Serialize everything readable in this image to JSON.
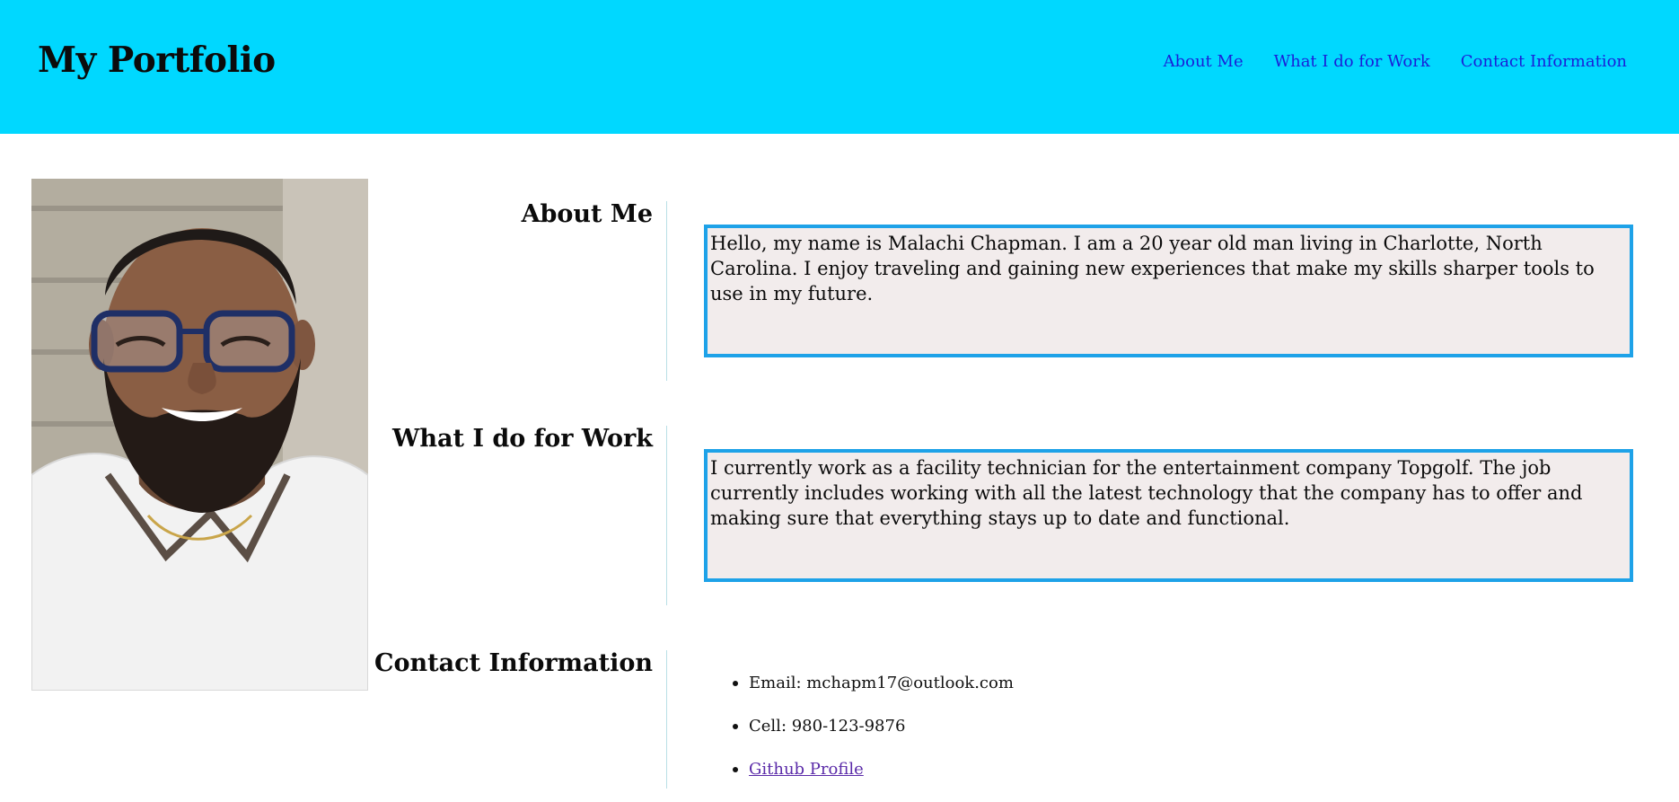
{
  "header": {
    "title": "My Portfolio",
    "nav": [
      "About Me",
      "What I do for Work",
      "Contact Information"
    ]
  },
  "sections": {
    "about": {
      "heading": "About Me",
      "body": "Hello, my name is Malachi Chapman. I am a 20 year old man living in Charlotte, North Carolina. I enjoy traveling and gaining new experiences that make my skills sharper tools to use in my future."
    },
    "work": {
      "heading": "What I do for Work",
      "body": "I currently work as a facility technician for the entertainment company Topgolf. The job currently includes working with all the latest technology that the company has to offer and making sure that everything stays up to date and functional."
    },
    "contact": {
      "heading": "Contact Information",
      "items": [
        "Email: mchapm17@outlook.com",
        "Cell: 980-123-9876",
        "Github Profile"
      ]
    }
  },
  "colors": {
    "header_bg": "#00d8ff",
    "nav_link": "#1a1fd8",
    "box_border": "#1ea2e8",
    "box_bg": "#f2ecec",
    "visited_link": "#5a2aa8"
  }
}
